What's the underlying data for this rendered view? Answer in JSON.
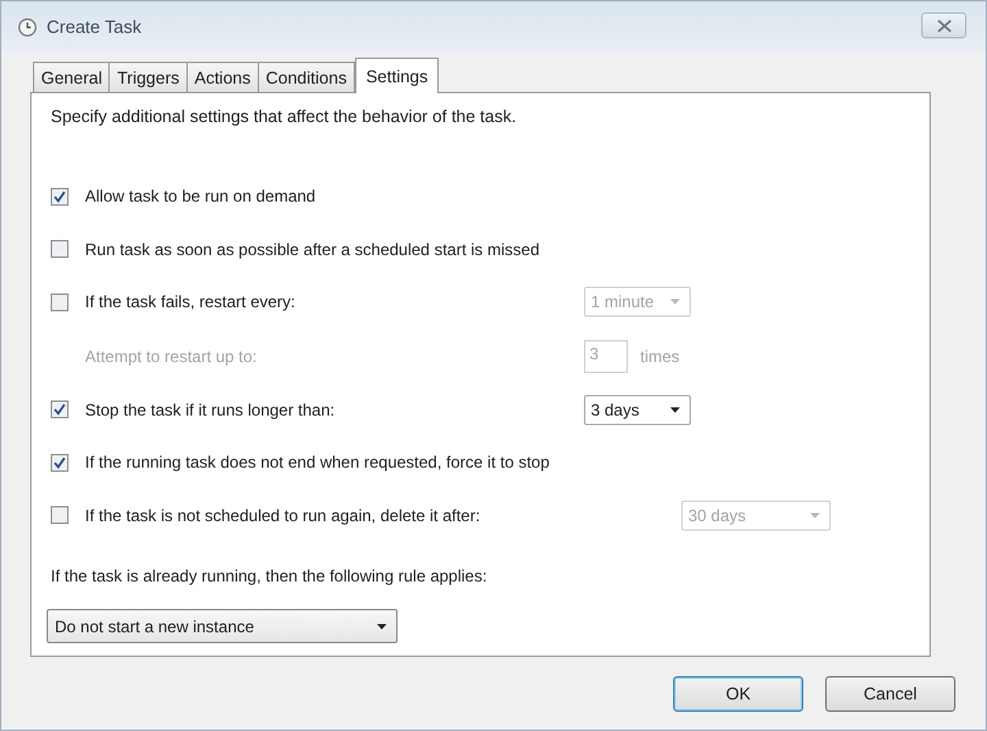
{
  "window": {
    "title": "Create Task"
  },
  "tabs": [
    {
      "label": "General",
      "selected": false
    },
    {
      "label": "Triggers",
      "selected": false
    },
    {
      "label": "Actions",
      "selected": false
    },
    {
      "label": "Conditions",
      "selected": false
    },
    {
      "label": "Settings",
      "selected": true
    }
  ],
  "intro": "Specify additional settings that affect the behavior of the task.",
  "settings": [
    {
      "kind": "checkbox",
      "label": "Allow task to be run on demand",
      "checked": true
    },
    {
      "kind": "checkbox",
      "label": "Run task as soon as possible after a scheduled start is missed",
      "checked": false
    },
    {
      "kind": "checkbox",
      "label": "If the task fails, restart every:",
      "checked": false,
      "control": {
        "kind": "dropdown",
        "value": "1 minute",
        "disabled": true
      }
    },
    {
      "kind": "sub",
      "label": "Attempt to restart up to:",
      "disabled": true,
      "control": {
        "kind": "spin",
        "value": "3",
        "disabled": true,
        "suffix": "times"
      }
    },
    {
      "kind": "checkbox",
      "label": "Stop the task if it runs longer than:",
      "checked": true,
      "control": {
        "kind": "dropdown",
        "value": "3 days",
        "disabled": false
      }
    },
    {
      "kind": "checkbox",
      "label": "If the running task does not end when requested, force it to stop",
      "checked": true
    },
    {
      "kind": "checkbox",
      "label": "If the task is not scheduled to run again, delete it after:",
      "checked": false,
      "control": {
        "kind": "dropdown",
        "value": "30 days",
        "disabled": true
      }
    }
  ],
  "rule": {
    "label": "If the task is already running, then the following rule applies:",
    "value": "Do not start a new instance"
  },
  "buttons": [
    {
      "label": "OK",
      "kind": "default"
    },
    {
      "label": "Cancel",
      "kind": "normal"
    }
  ]
}
